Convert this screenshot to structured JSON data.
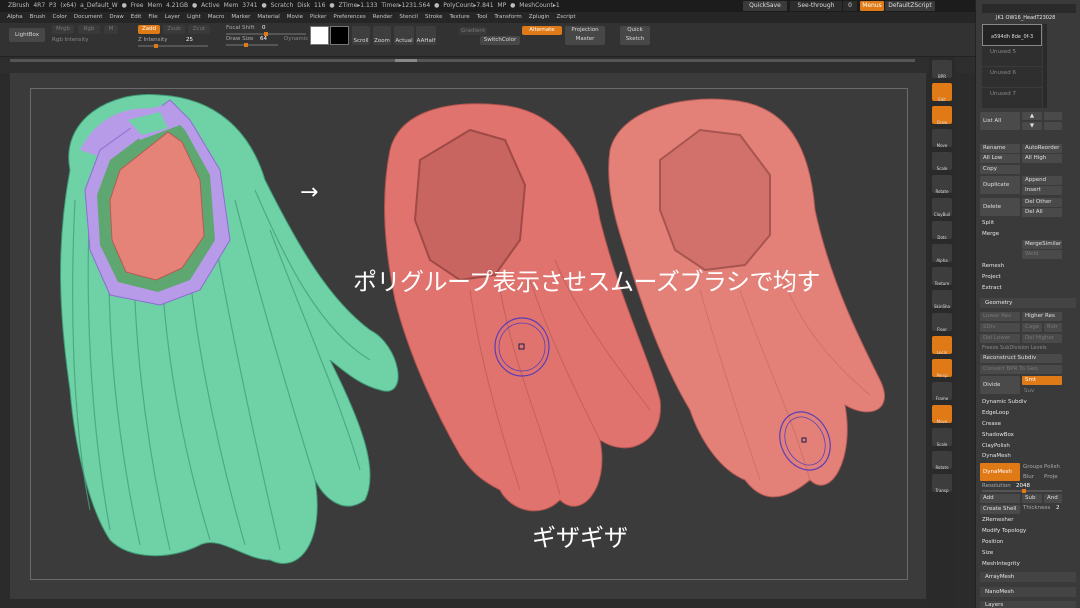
{
  "titlebar": {
    "text": "ZBrush 4R7 P3 (x64)   a_Default_W   ● Free Mem 4.21GB ● Active Mem 3741 ● Scratch Disk 116 ● ZTime▸1.133 Timer▸1231.564 ● PolyCount▸7.841 MP ● MeshCount▸1",
    "quicksave": "QuickSave",
    "seethrough": "See-through",
    "seethrough_val": "0",
    "menus": "Menus",
    "script": "DefaultZScript"
  },
  "menubar": [
    "Alpha",
    "Brush",
    "Color",
    "Document",
    "Draw",
    "Edit",
    "File",
    "Layer",
    "Light",
    "Macro",
    "Marker",
    "Material",
    "Movie",
    "Picker",
    "Preferences",
    "Render",
    "Stencil",
    "Stroke",
    "Texture",
    "Tool",
    "Transform",
    "Zplugin",
    "Zscript"
  ],
  "toolbar": {
    "lightbox": "LightBox",
    "mrgb": "Mrgb",
    "rgb": "Rgb",
    "m": "M",
    "zadd": "Zadd",
    "zsub": "Zsub",
    "zcut": "Zcut",
    "focal_shift_label": "Focal Shift",
    "focal_shift_value": "0",
    "draw_size_label": "Draw Size",
    "draw_size_value": "64",
    "dynamic": "Dynamic",
    "rgb_intensity": "Rgb Intensity",
    "z_intensity_label": "Z Intensity",
    "z_intensity_value": "25",
    "scroll": "Scroll",
    "zoom": "Zoom",
    "actual": "Actual",
    "aahalf": "AAHalf",
    "gradient": "Gradient",
    "switchcolor": "SwitchColor",
    "alternate": "Alternate",
    "proj_master": "Projection Master",
    "quick_sketch": "Quick Sketch"
  },
  "shelf": [
    "BPR",
    "Edit",
    "Draw",
    "Move",
    "Scale",
    "Rotate",
    "ClayBuil",
    "Dots",
    "Alpha",
    "Texture",
    "SkinSha",
    "Floor",
    "Local",
    "Persp",
    "Frame",
    "Move",
    "Scale",
    "Rotate",
    "Transp"
  ],
  "rpanel": {
    "tool_name": "JK1 OW16_HeadT23028",
    "subtool_sel": "a594dh 8de_0f-3",
    "unused": [
      "Unused 5",
      "Unused 6",
      "Unused 7"
    ],
    "list_all": "List All",
    "rows": [
      [
        "Rename",
        "AutoReorder"
      ],
      [
        "All Low",
        "All High"
      ],
      [
        "Copy",
        ""
      ],
      [
        "Duplicate",
        "Append"
      ],
      [
        "",
        "Insert"
      ],
      [
        "Delete",
        "Del Other"
      ],
      [
        "",
        "Del All"
      ]
    ],
    "split": "Split",
    "merge": "Merge",
    "merge_similar": "MergeSimilar",
    "weld": "Weld",
    "remesh": "Remesh",
    "project": "Project",
    "extract": "Extract",
    "geometry": "Geometry",
    "lower_res": "Lower Res",
    "higher_res": "Higher Res",
    "sdiv": "SDiv",
    "cage": "Cage",
    "rstr": "Rstr",
    "del_lower": "Del Lower",
    "del_higher": "Del Higher",
    "freeze": "Freeze SubDivision Levels",
    "reconstruct": "Reconstruct Subdiv",
    "convert_bpr": "Convert BPR To Geo",
    "divide": "Divide",
    "smt": "Smt",
    "suv": "Suv",
    "dynamic_subdiv": "Dynamic Subdiv",
    "edgeloop": "EdgeLoop",
    "crease": "Crease",
    "shadowbox": "ShadowBox",
    "claypolish": "ClayPolish",
    "dynamesh_title": "DynaMesh",
    "dynamesh": "DynaMesh",
    "groups": "Groups",
    "polish": "Polish",
    "blur": "Blur",
    "project2": "Proje",
    "resolution_label": "Resolution",
    "resolution_value": "2048",
    "add": "Add",
    "sub": "Sub",
    "and": "And",
    "create_shell": "Create Shell",
    "thickness": "Thickness",
    "thickness_value": "2",
    "zremesher": "ZRemesher",
    "modify_topology": "Modify Topology",
    "position": "Position",
    "size": "Size",
    "meshintegrity": "MeshIntegrity",
    "arraymesh": "ArrayMesh",
    "nanomesh": "NanoMesh",
    "layers": "Layers"
  },
  "viewport": {
    "arrow": "→",
    "caption_main": "ポリグループ表示させスムーズブラシで均す",
    "caption_jagged": "ギザギザ"
  },
  "colors": {
    "accent": "#e07a17",
    "hair_green": "#6fd1a6",
    "hair_red": "#e0736e",
    "polygroup_purple": "#b79be8",
    "brush_ring": "#5a3db8"
  }
}
